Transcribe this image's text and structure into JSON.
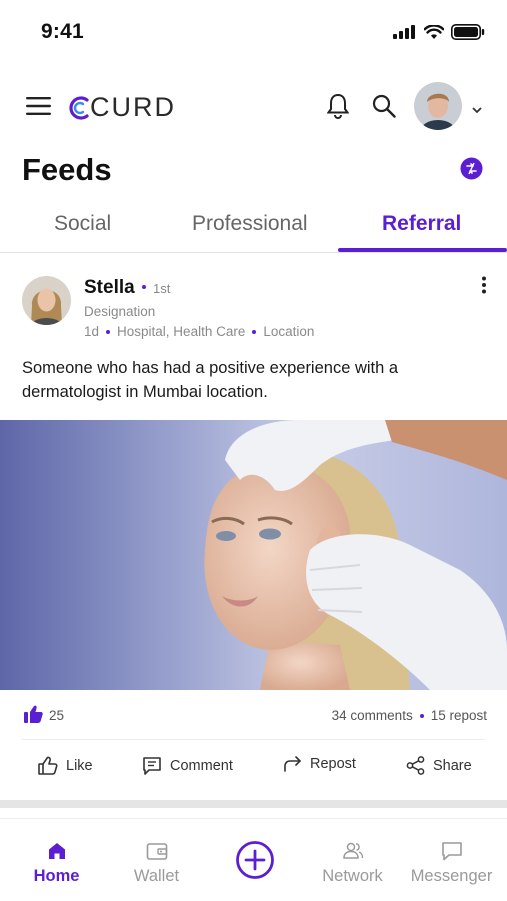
{
  "status_bar": {
    "time": "9:41"
  },
  "header": {
    "logo_text": "CURD"
  },
  "page": {
    "title": "Feeds"
  },
  "tabs": [
    {
      "label": "Social"
    },
    {
      "label": "Professional"
    },
    {
      "label": "Referral"
    }
  ],
  "post": {
    "author": "Stella",
    "degree": "1st",
    "designation": "Designation",
    "time_ago": "1d",
    "industry": "Hospital, Health Care",
    "location": "Location",
    "text": "Someone who has had a positive experience with a dermatologist in Mumbai location.",
    "likes": "25",
    "comments": "34 comments",
    "reposts": "15 repost"
  },
  "actions": {
    "like": "Like",
    "comment": "Comment",
    "repost": "Repost",
    "share": "Share"
  },
  "bottom_nav": {
    "home": "Home",
    "wallet": "Wallet",
    "network": "Network",
    "messenger": "Messenger"
  },
  "colors": {
    "accent": "#5b1fd1"
  }
}
